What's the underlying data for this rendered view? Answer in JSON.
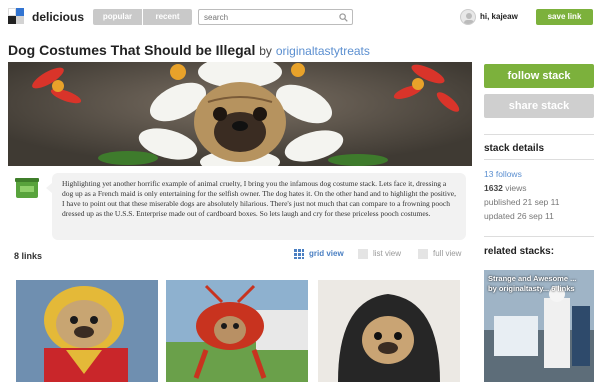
{
  "header": {
    "brand": "delicious",
    "tabs": [
      "popular",
      "recent"
    ],
    "search_placeholder": "search",
    "user_greeting": "hi, kajeaw",
    "save_link": "save link"
  },
  "stack": {
    "title": "Dog Costumes That Should be Illegal",
    "by_label": "by",
    "author": "originaltastytreats",
    "description": "Highlighting yet another horrific example of animal cruelty, I bring you the infamous dog costume stack. Lets face it, dressing a dog up as a French maid is only entertaining for the selfish owner. The dog hates it.  On the other hand and to highlight the positive, I have to point out that these miserable dogs are absolutely hilarious. There's just not much that can compare to a frowning pooch dressed up as the U.S.S. Enterprise made out of cardboard boxes. So lets laugh and cry for these priceless pooch costumes.",
    "links_count": "8 links",
    "views": [
      "grid view",
      "list view",
      "full view"
    ]
  },
  "sidebar": {
    "follow": "follow stack",
    "share": "share stack",
    "details_heading": "stack details",
    "follows_num": "13",
    "follows_label": "follows",
    "views_num": "1632",
    "views_label": "views",
    "published": "published 21 sep 11",
    "updated": "updated 26 sep 11",
    "related_heading": "related stacks:",
    "related_title": "Strange and Awesome ...",
    "related_by": "by originaltasty... 6 links"
  },
  "colors": {
    "accent_green": "#7cb13c",
    "link_blue": "#5b8fd0",
    "disabled_gray": "#cfcfcf"
  },
  "icons": [
    "delicious-logo",
    "search-icon",
    "avatar",
    "grid-view-icon",
    "list-view-icon",
    "full-view-icon"
  ]
}
